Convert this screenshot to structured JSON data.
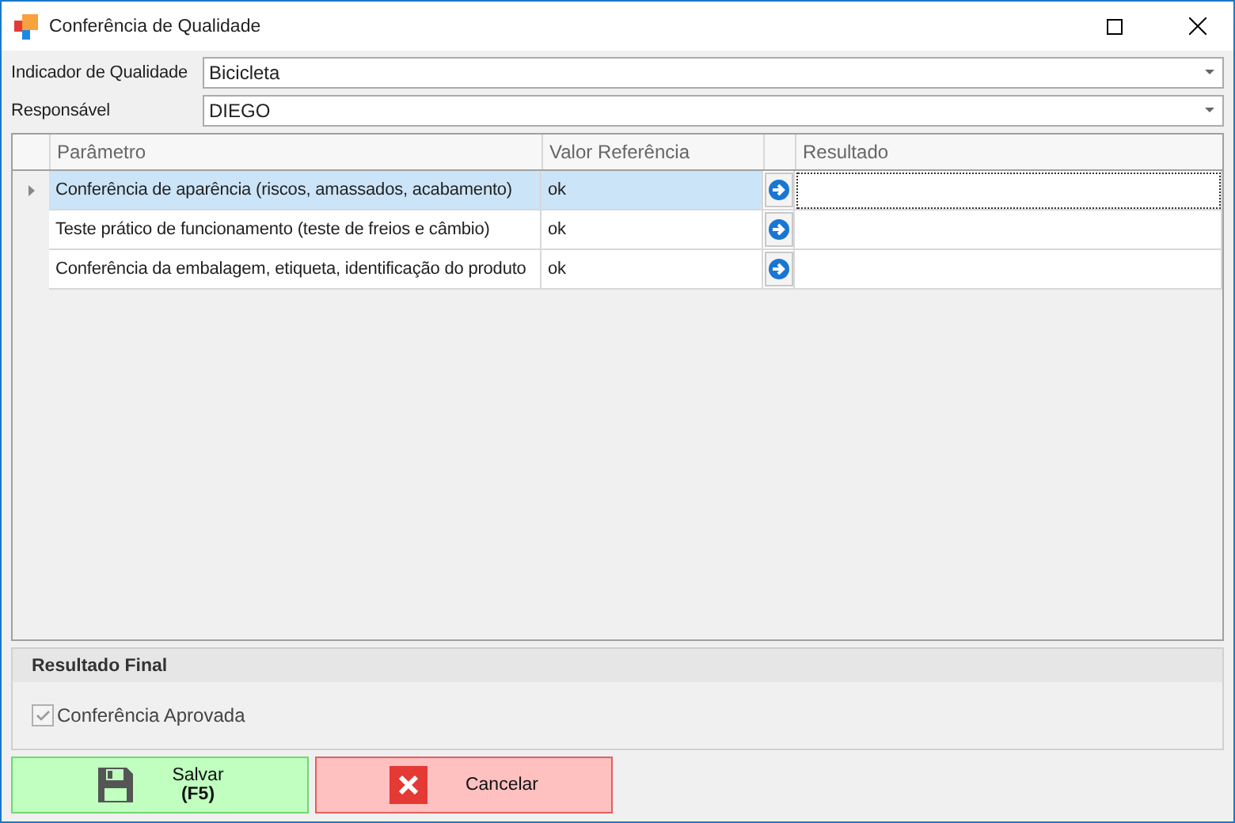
{
  "window": {
    "title": "Conferência de Qualidade"
  },
  "fields": [
    {
      "label": "Indicador de Qualidade",
      "value": "Bicicleta"
    },
    {
      "label": "Responsável",
      "value": "DIEGO"
    }
  ],
  "table": {
    "columns": [
      "Parâmetro",
      "Valor Referência",
      "Resultado"
    ],
    "rows": [
      {
        "parametro": "Conferência de aparência (riscos, amassados, acabamento)",
        "valor": "ok",
        "resultado": "",
        "selected": true
      },
      {
        "parametro": "Teste prático de funcionamento (teste de freios e câmbio)",
        "valor": "ok",
        "resultado": "",
        "selected": false
      },
      {
        "parametro": "Conferência da embalagem, etiqueta, identificação do produto",
        "valor": "ok",
        "resultado": "",
        "selected": false
      }
    ]
  },
  "final": {
    "title": "Resultado Final",
    "checkbox": {
      "label": "Conferência Aprovada",
      "checked": true,
      "disabled": true
    }
  },
  "buttons": [
    {
      "kind": "save",
      "label": "Salvar",
      "shortcut": "(F5)"
    },
    {
      "kind": "cancel",
      "label": "Cancelar"
    }
  ]
}
